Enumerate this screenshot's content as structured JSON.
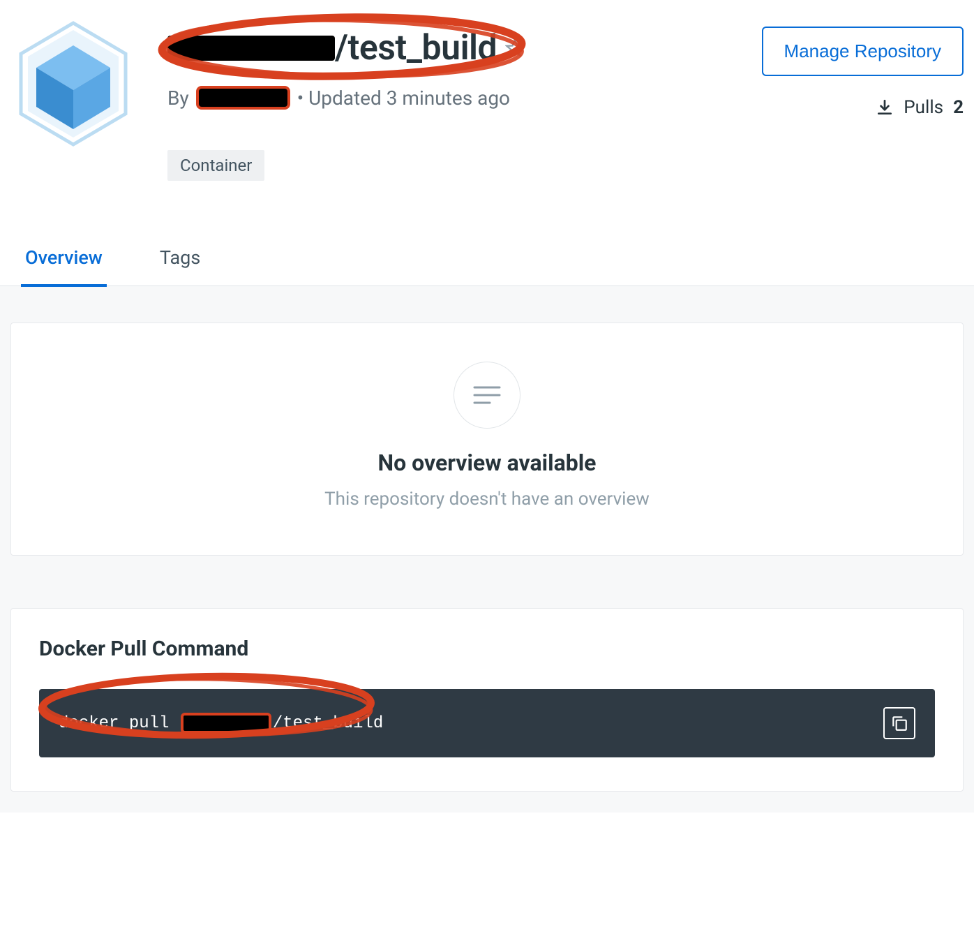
{
  "header": {
    "title_redacted": true,
    "title_suffix": "/test_build",
    "byline_prefix": "By ",
    "byline_redacted": true,
    "updated_text": "• Updated 3 minutes ago",
    "tags": [
      "Container"
    ],
    "manage_button_label": "Manage Repository",
    "pulls_label": "Pulls",
    "pulls_count": "2"
  },
  "tabs": {
    "overview": "Overview",
    "tags": "Tags",
    "active": "overview"
  },
  "overview": {
    "title": "No overview available",
    "subtitle": "This repository doesn't have an overview"
  },
  "pull": {
    "section_title": "Docker Pull Command",
    "command_prefix": "docker pull ",
    "command_redacted": true,
    "command_suffix": "/test_build"
  },
  "icons": {
    "repo": "cube-icon",
    "star": "star-outline-icon",
    "download": "download-icon",
    "placeholder": "lines-icon",
    "copy": "copy-icon"
  },
  "annotation_color": "#d8401f"
}
